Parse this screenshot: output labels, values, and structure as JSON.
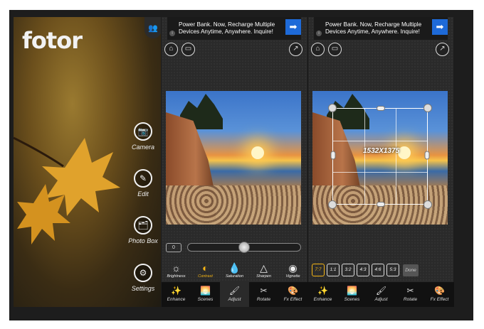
{
  "home": {
    "logo": "fotor",
    "items": [
      {
        "label": "Camera",
        "icon": "camera-icon",
        "glyph": "📷"
      },
      {
        "label": "Edit",
        "icon": "pencil-icon",
        "glyph": "✎"
      },
      {
        "label": "Photo Box",
        "icon": "folder-icon",
        "glyph": "🗂"
      },
      {
        "label": "Settings",
        "icon": "gear-icon",
        "glyph": "⚙"
      }
    ]
  },
  "ad": {
    "text": "Power Bank. Now, Recharge Multiple Devices Anytime, Anywhere. Inquire!",
    "info_glyph": "i",
    "go_glyph": "➡"
  },
  "adjust": {
    "slider_value": "0",
    "slider_level": 0.5,
    "tools": [
      {
        "label": "Brightness",
        "glyph": "☼"
      },
      {
        "label": "Contrast",
        "glyph": "◐"
      },
      {
        "label": "Saturation",
        "glyph": "💧"
      },
      {
        "label": "Sharpen",
        "glyph": "△"
      },
      {
        "label": "Vignette",
        "glyph": "◉"
      }
    ],
    "active_tool": "Contrast"
  },
  "crop": {
    "size_label": "1532X1375",
    "ratios": [
      "7:7",
      "1:1",
      "3:2",
      "4:3",
      "4:6",
      "5:3"
    ],
    "active_ratio": "7:7",
    "done_label": "Done"
  },
  "bottom_tabs": [
    {
      "label": "Enhance",
      "glyph": "✨"
    },
    {
      "label": "Scenes",
      "glyph": "🌅"
    },
    {
      "label": "Adjust",
      "glyph": "🖌"
    },
    {
      "label": "Rotate",
      "glyph": "✂"
    },
    {
      "label": "Fx Effect",
      "glyph": "🎨"
    }
  ],
  "colors": {
    "accent": "#f5b515",
    "ad_button": "#1e6ad8"
  }
}
